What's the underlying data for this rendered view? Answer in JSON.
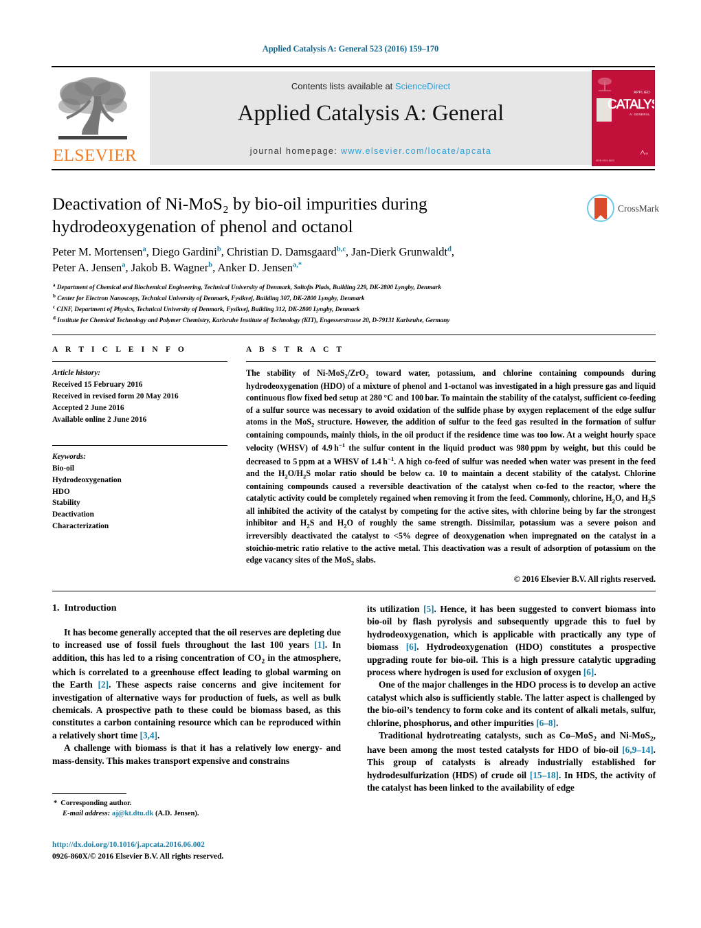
{
  "running_head": "Applied Catalysis A: General 523 (2016) 159–170",
  "masthead": {
    "contents_prefix": "Contents lists available at ",
    "sciencedirect": "ScienceDirect",
    "journal_title": "Applied Catalysis A: General",
    "homepage_prefix": "journal homepage:",
    "homepage_url": "www.elsevier.com/locate/apcata",
    "publisher": "ELSEVIER",
    "cover": {
      "word": "CATALYSIS",
      "top_small": "APPLIED",
      "sub_small": "A: GENERAL",
      "foot_left": "ISSN 0926-860X",
      "foot_right": "Available online at\nScienceDirect"
    },
    "colors": {
      "link": "#2a9fd6",
      "elsevier_orange": "#f47b20",
      "cover_red": "#c2103a",
      "masthead_grey": "#e6e6e6"
    }
  },
  "article": {
    "title_line1": "Deactivation of Ni-MoS₂ by bio-oil impurities during",
    "title_line2": "hydrodeoxygenation of phenol and octanol",
    "crossmark_label": "CrossMark",
    "authors": [
      {
        "name": "Peter M. Mortensen",
        "marks": "a",
        "sep": ", "
      },
      {
        "name": "Diego Gardini",
        "marks": "b",
        "sep": ", "
      },
      {
        "name": "Christian D. Damsgaard",
        "marks": "b,c",
        "sep": ", "
      },
      {
        "name": "Jan-Dierk Grunwaldt",
        "marks": "d",
        "sep": ", "
      },
      {
        "name": "Peter A. Jensen",
        "marks": "a",
        "sep": ", "
      },
      {
        "name": "Jakob B. Wagner",
        "marks": "b",
        "sep": ", "
      },
      {
        "name": "Anker D. Jensen",
        "marks": "a,*",
        "sep": ""
      }
    ],
    "affiliations": [
      {
        "mark": "a",
        "text": "Department of Chemical and Biochemical Engineering, Technical University of Denmark, Søltofts Plads, Building 229, DK-2800 Lyngby, Denmark"
      },
      {
        "mark": "b",
        "text": "Center for Electron Nanoscopy, Technical University of Denmark, Fysikvej, Building 307, DK-2800 Lyngby, Denmark"
      },
      {
        "mark": "c",
        "text": "CINF, Department of Physics, Technical University of Denmark, Fysikvej, Building 312, DK-2800 Lyngby, Denmark"
      },
      {
        "mark": "d",
        "text": "Institute for Chemical Technology and Polymer Chemistry, Karlsruhe Institute of Technology (KIT), Engesserstrasse 20, D-79131 Karlsruhe, Germany"
      }
    ]
  },
  "article_info": {
    "heading": "A R T I C L E   I N F O",
    "history_label": "Article history:",
    "history": [
      "Received 15 February 2016",
      "Received in revised form 20 May 2016",
      "Accepted 2 June 2016",
      "Available online 2 June 2016"
    ],
    "keywords_label": "Keywords:",
    "keywords": [
      "Bio-oil",
      "Hydrodeoxygenation",
      "HDO",
      "Stability",
      "Deactivation",
      "Characterization"
    ]
  },
  "abstract": {
    "heading": "A B S T R A C T",
    "copyright": "© 2016 Elsevier B.V. All rights reserved."
  },
  "introduction": {
    "number": "1.",
    "heading": "Introduction"
  },
  "footnote": {
    "star": "*",
    "corresponding": "Corresponding author.",
    "email_label": "E-mail address:",
    "email": "aj@kt.dtu.dk",
    "email_owner": "(A.D. Jensen)."
  },
  "doi_block": {
    "doi": "http://dx.doi.org/10.1016/j.apcata.2016.06.002",
    "issn_line": "0926-860X/© 2016 Elsevier B.V. All rights reserved."
  }
}
